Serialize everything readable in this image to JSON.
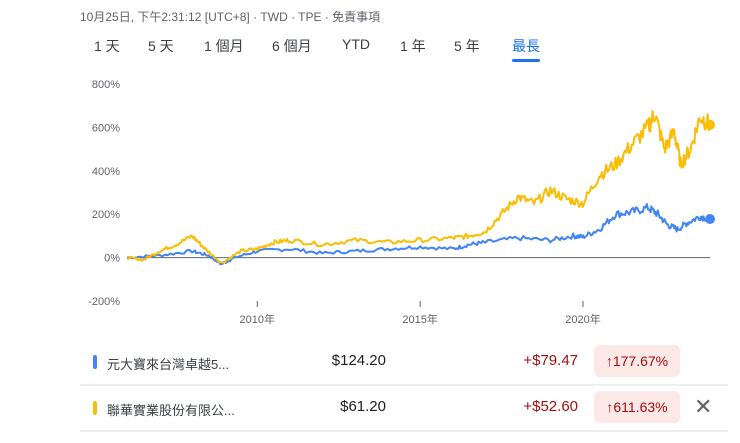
{
  "header": {
    "subtitle": "10月25日, 下午2:31:12 [UTC+8] · TWD · TPE · 免責事項"
  },
  "tabs": [
    {
      "label": "1 天"
    },
    {
      "label": "5 天"
    },
    {
      "label": "1 個月"
    },
    {
      "label": "6 個月"
    },
    {
      "label": "YTD"
    },
    {
      "label": "1 年"
    },
    {
      "label": "5 年"
    },
    {
      "label": "最長",
      "active": true
    }
  ],
  "chart_data": {
    "type": "line",
    "yticks": [
      "800%",
      "600%",
      "400%",
      "200%",
      "0%",
      "-200%"
    ],
    "ytick_values": [
      800,
      600,
      400,
      200,
      0,
      -200
    ],
    "xticks": [
      "2010年",
      "2015年",
      "2020年"
    ],
    "xtick_values": [
      2010,
      2015,
      2020
    ],
    "xlim": [
      2006,
      2023.9
    ],
    "ylim": [
      -200,
      800
    ],
    "series": [
      {
        "name": "元大寶來台灣卓越5...",
        "color": "#4285f4",
        "x": [
          2006,
          2007,
          2008,
          2008.5,
          2008.9,
          2009.3,
          2010,
          2011,
          2012,
          2013,
          2014,
          2015,
          2016,
          2016.5,
          2017,
          2018,
          2019,
          2019.7,
          2020,
          2020.5,
          2021,
          2021.5,
          2022,
          2022.3,
          2022.6,
          2022.9,
          2023.2,
          2023.6,
          2023.9
        ],
        "y": [
          0,
          10,
          30,
          10,
          -30,
          0,
          30,
          40,
          20,
          30,
          40,
          50,
          40,
          60,
          70,
          90,
          80,
          100,
          95,
          130,
          200,
          210,
          230,
          200,
          150,
          130,
          160,
          190,
          178
        ]
      },
      {
        "name": "聯華實業股份有限公...",
        "color": "#fbbc04",
        "x": [
          2006,
          2006.5,
          2007,
          2007.5,
          2008,
          2008.4,
          2008.9,
          2009.5,
          2010,
          2010.5,
          2011,
          2012,
          2013,
          2014,
          2015,
          2016,
          2016.5,
          2017,
          2017.5,
          2018,
          2018.5,
          2019,
          2019.5,
          2020,
          2020.5,
          2021,
          2021.5,
          2022,
          2022.2,
          2022.5,
          2022.8,
          2023,
          2023.3,
          2023.6,
          2023.9
        ],
        "y": [
          0,
          -10,
          30,
          60,
          100,
          40,
          -25,
          30,
          40,
          70,
          80,
          60,
          80,
          70,
          80,
          90,
          100,
          120,
          200,
          280,
          250,
          310,
          270,
          250,
          380,
          430,
          520,
          600,
          665,
          500,
          580,
          430,
          500,
          650,
          612
        ]
      }
    ]
  },
  "rows": [
    {
      "name": "元大寶來台灣卓越5...",
      "price": "$124.20",
      "change": "+$79.47",
      "percent": "177.67%",
      "color": "#4285f4"
    },
    {
      "name": "聯華實業股份有限公...",
      "price": "$61.20",
      "change": "+$52.60",
      "percent": "611.63%",
      "color": "#fbbc04",
      "close": "✕"
    }
  ]
}
